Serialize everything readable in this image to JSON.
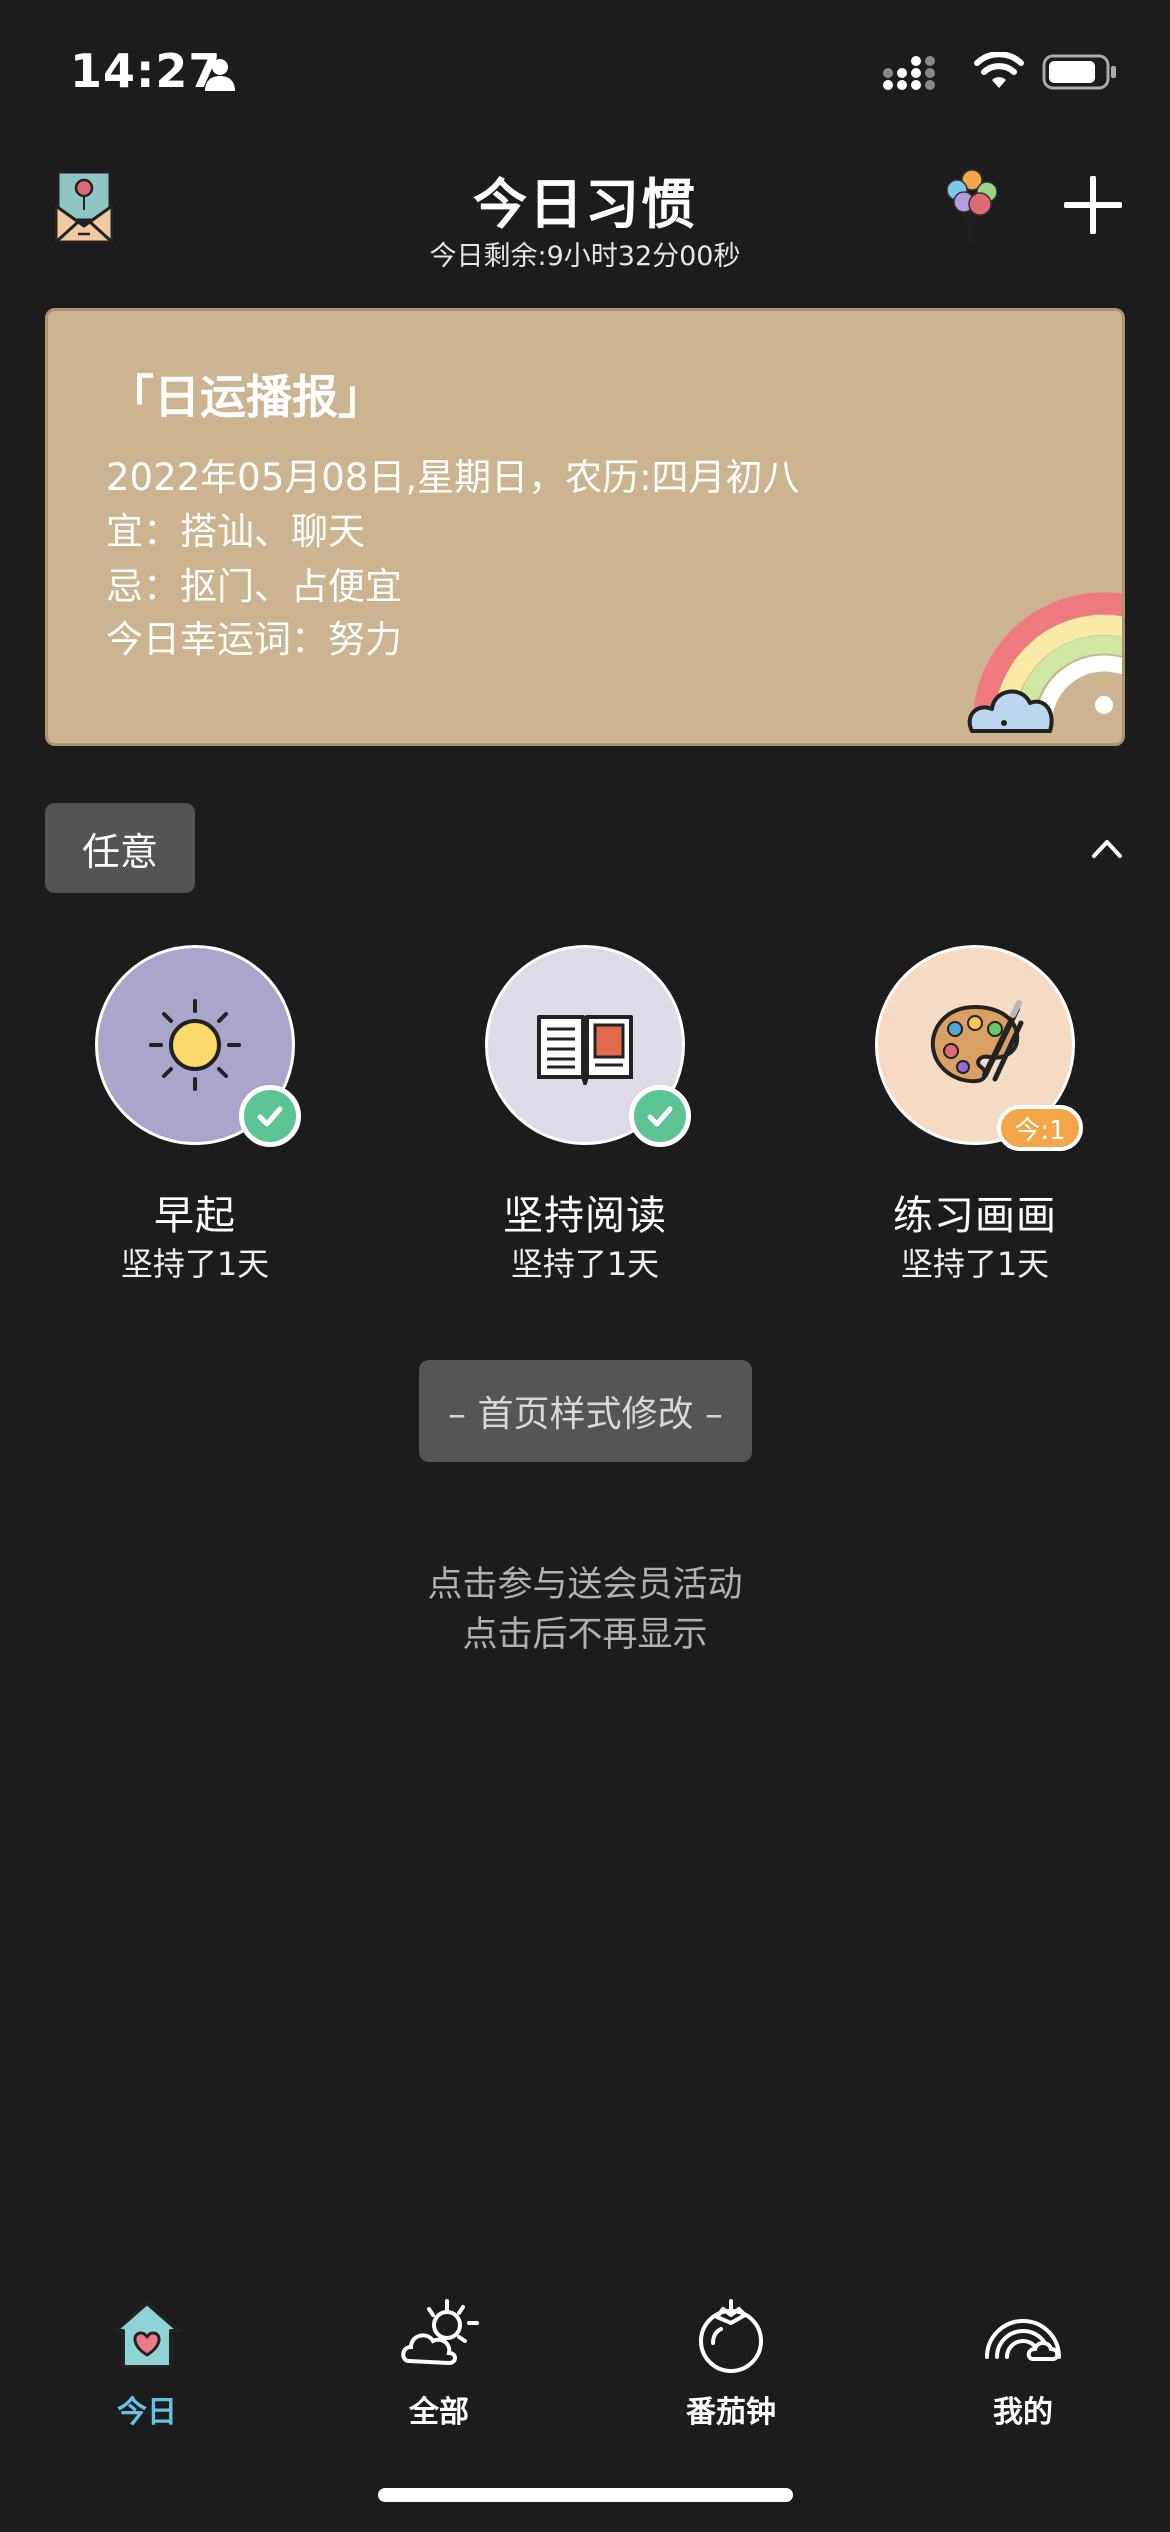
{
  "status_bar": {
    "time": "14:27"
  },
  "header": {
    "title": "今日习惯",
    "subtitle": "今日剩余:9小时32分00秒"
  },
  "fortune": {
    "title": "「日运播报」",
    "date_line": "2022年05月08日,星期日，农历:四月初八",
    "good_line": "宜：搭讪、聊天",
    "bad_line": "忌：抠门、占便宜",
    "lucky_line": "今日幸运词：努力"
  },
  "filter_tag": "任意",
  "habits": [
    {
      "name": "早起",
      "streak": "坚持了1天",
      "icon": "sun-icon",
      "color": "#aaa6cb",
      "done": true
    },
    {
      "name": "坚持阅读",
      "streak": "坚持了1天",
      "icon": "book-icon",
      "color": "#dcdbe7",
      "done": true
    },
    {
      "name": "练习画画",
      "streak": "坚持了1天",
      "icon": "palette-icon",
      "color": "#f5dac4",
      "badge": "今:1"
    }
  ],
  "style_button": "– 首页样式修改 –",
  "promo": {
    "line1": "点击参与送会员活动",
    "line2": "点击后不再显示"
  },
  "tabs": [
    {
      "label": "今日",
      "icon": "home-heart-icon",
      "active": true
    },
    {
      "label": "全部",
      "icon": "sun-cloud-icon"
    },
    {
      "label": "番茄钟",
      "icon": "tomato-icon"
    },
    {
      "label": "我的",
      "icon": "rainbow-icon"
    }
  ],
  "colors": {
    "accent": "#66c2e0",
    "card": "#ccb491",
    "check": "#5cc394",
    "badge": "#f2a648",
    "background": "#1c1c1d"
  }
}
